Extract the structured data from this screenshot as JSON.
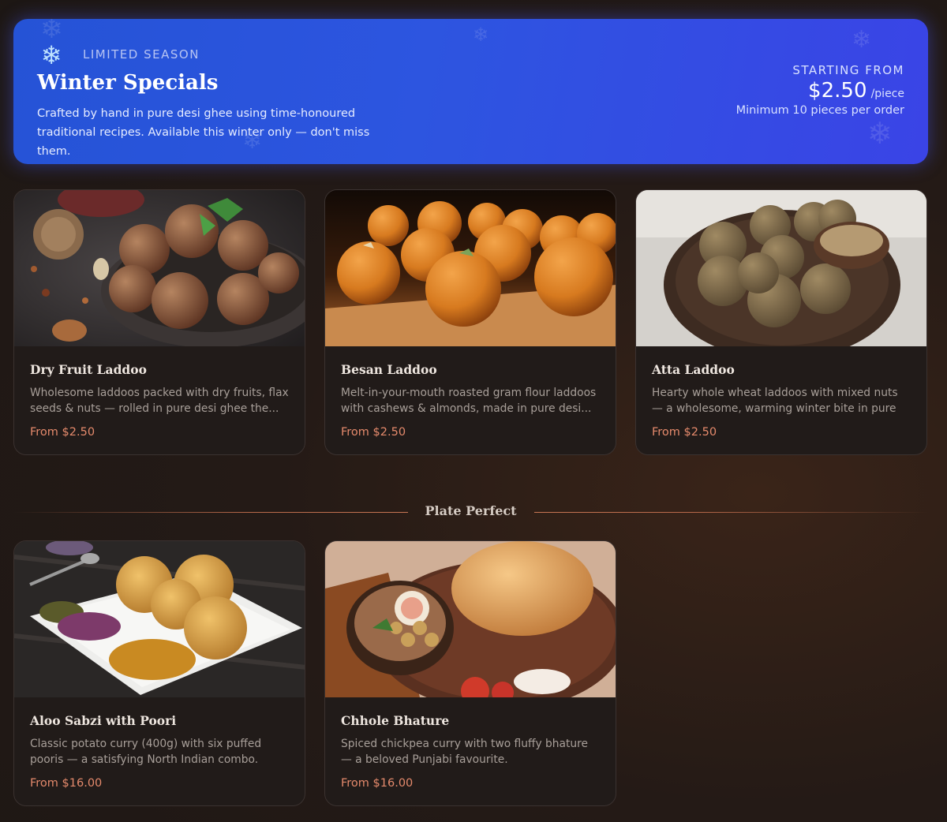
{
  "banner": {
    "eyebrow": "LIMITED SEASON",
    "title": "Winter Specials",
    "description": "Crafted by hand in pure desi ghee using time-honoured traditional recipes. Available this winter only — don't miss them.",
    "icon": "snowflake-icon",
    "price_eyebrow": "STARTING FROM",
    "price": "$2.50",
    "price_unit": "/piece",
    "price_note": "Minimum 10 pieces per order"
  },
  "winter_items": [
    {
      "name": "Dry Fruit Laddoo",
      "description": "Wholesome laddoos packed with dry fruits, flax seeds & nuts — rolled in pure desi ghee the...",
      "price": "From $2.50"
    },
    {
      "name": "Besan Laddoo",
      "description": "Melt-in-your-mouth roasted gram flour laddoos with cashews & almonds, made in pure desi...",
      "price": "From $2.50"
    },
    {
      "name": "Atta Laddoo",
      "description": "Hearty whole wheat laddoos with mixed nuts — a wholesome, warming winter bite in pure desi...",
      "price": "From $2.50"
    }
  ],
  "section": {
    "title": "Plate Perfect"
  },
  "plate_items": [
    {
      "name": "Aloo Sabzi with Poori",
      "description": "Classic potato curry (400g) with six puffed pooris — a satisfying North Indian combo.",
      "price": "From $16.00"
    },
    {
      "name": "Chhole Bhature",
      "description": "Spiced chickpea curry with two fluffy bhature — a beloved Punjabi favourite.",
      "price": "From $16.00"
    }
  ],
  "colors": {
    "banner_start": "#2553d6",
    "banner_end": "#3a44e6",
    "price_accent": "#e58a6c",
    "card_bg": "#211b19"
  }
}
